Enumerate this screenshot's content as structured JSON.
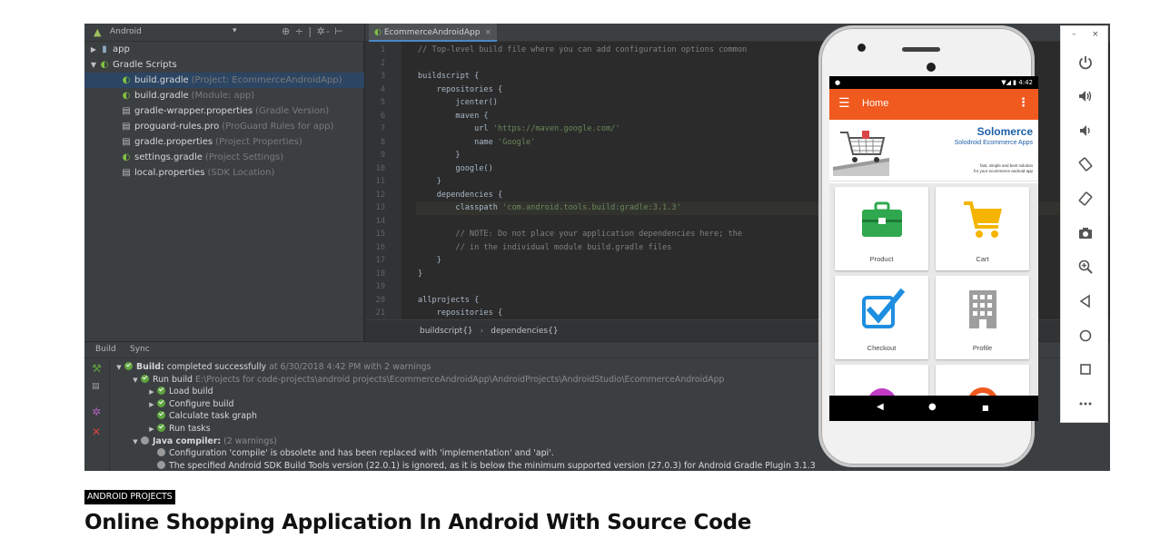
{
  "ide": {
    "project_panel": {
      "view_selector": "Android",
      "tree": [
        {
          "label": "app",
          "detail": "",
          "icon": "folder-icon",
          "arrow": "▶",
          "indent": 0
        },
        {
          "label": "Gradle Scripts",
          "detail": "",
          "icon": "gradle-icon",
          "arrow": "▼",
          "indent": 0
        },
        {
          "label": "build.gradle",
          "detail": "(Project: EcommerceAndroidApp)",
          "icon": "gradle-icon",
          "arrow": "",
          "indent": 1,
          "selected": true
        },
        {
          "label": "build.gradle",
          "detail": "(Module: app)",
          "icon": "gradle-icon",
          "arrow": "",
          "indent": 1
        },
        {
          "label": "gradle-wrapper.properties",
          "detail": "(Gradle Version)",
          "icon": "properties-file-icon",
          "arrow": "",
          "indent": 1
        },
        {
          "label": "proguard-rules.pro",
          "detail": "(ProGuard Rules for app)",
          "icon": "file-icon",
          "arrow": "",
          "indent": 1
        },
        {
          "label": "gradle.properties",
          "detail": "(Project Properties)",
          "icon": "properties-file-icon",
          "arrow": "",
          "indent": 1
        },
        {
          "label": "settings.gradle",
          "detail": "(Project Settings)",
          "icon": "gradle-icon",
          "arrow": "",
          "indent": 1
        },
        {
          "label": "local.properties",
          "detail": "(SDK Location)",
          "icon": "properties-file-icon",
          "arrow": "",
          "indent": 1
        }
      ]
    },
    "editor": {
      "tab_label": "EcommerceAndroidApp",
      "lines": [
        {
          "n": "1",
          "text": "// Top-level build file where you can add configuration options common",
          "kind": "comment"
        },
        {
          "n": "2",
          "text": "",
          "kind": "code"
        },
        {
          "n": "3",
          "text": "buildscript {",
          "kind": "code"
        },
        {
          "n": "4",
          "text": "    repositories {",
          "kind": "code"
        },
        {
          "n": "5",
          "text": "        jcenter()",
          "kind": "code"
        },
        {
          "n": "6",
          "text": "        maven {",
          "kind": "code"
        },
        {
          "n": "7",
          "text": "            url 'https://maven.google.com/'",
          "kind": "string"
        },
        {
          "n": "8",
          "text": "            name 'Google'",
          "kind": "string"
        },
        {
          "n": "9",
          "text": "        }",
          "kind": "code"
        },
        {
          "n": "10",
          "text": "        google()",
          "kind": "code"
        },
        {
          "n": "11",
          "text": "    }",
          "kind": "code"
        },
        {
          "n": "12",
          "text": "    dependencies {",
          "kind": "code"
        },
        {
          "n": "13",
          "text": "        classpath 'com.android.tools.build:gradle:3.1.3'",
          "kind": "string",
          "highlight": true
        },
        {
          "n": "14",
          "text": "",
          "kind": "code"
        },
        {
          "n": "15",
          "text": "        // NOTE: Do not place your application dependencies here; the",
          "kind": "comment"
        },
        {
          "n": "16",
          "text": "        // in the individual module build.gradle files",
          "kind": "comment"
        },
        {
          "n": "17",
          "text": "    }",
          "kind": "code"
        },
        {
          "n": "18",
          "text": "}",
          "kind": "code"
        },
        {
          "n": "19",
          "text": "",
          "kind": "code"
        },
        {
          "n": "20",
          "text": "allprojects {",
          "kind": "code"
        },
        {
          "n": "21",
          "text": "    repositories {",
          "kind": "code"
        }
      ],
      "breadcrumbs": [
        "buildscript{}",
        "dependencies{}"
      ]
    },
    "build_panel": {
      "tabs": [
        "Build",
        "Sync"
      ],
      "rows": [
        {
          "arrow": "▼",
          "status": "ok",
          "bold": "Build:",
          "text": " completed successfully",
          "dim": "  at 6/30/2018 4:42 PM   with 2 warnings",
          "indent": 0
        },
        {
          "arrow": "▼",
          "status": "ok",
          "bold": "",
          "text": "Run build",
          "dim": "  E:\\Projects for code-projects\\android projects\\EcommerceAndroidApp\\AndroidProjects\\AndroidStudio\\EcommerceAndroidApp",
          "indent": 1
        },
        {
          "arrow": "▶",
          "status": "ok",
          "bold": "",
          "text": "Load build",
          "dim": "",
          "indent": 2
        },
        {
          "arrow": "▶",
          "status": "ok",
          "bold": "",
          "text": "Configure build",
          "dim": "",
          "indent": 2
        },
        {
          "arrow": "",
          "status": "ok",
          "bold": "",
          "text": "Calculate task graph",
          "dim": "",
          "indent": 2
        },
        {
          "arrow": "▶",
          "status": "ok",
          "bold": "",
          "text": "Run tasks",
          "dim": "",
          "indent": 2
        },
        {
          "arrow": "▼",
          "status": "grey",
          "bold": "Java compiler:",
          "text": "",
          "dim": "  (2 warnings)",
          "indent": 1
        },
        {
          "arrow": "",
          "status": "grey",
          "bold": "",
          "text": "Configuration 'compile' is obsolete and has been replaced with 'implementation' and 'api'.",
          "dim": "",
          "indent": 2
        },
        {
          "arrow": "",
          "status": "grey",
          "bold": "",
          "text": "The specified Android SDK Build Tools version (22.0.1) is ignored, as it is below the minimum supported version (27.0.3) for Android Gradle Plugin 3.1.3",
          "dim": "",
          "indent": 2
        }
      ]
    }
  },
  "phone_app": {
    "status_time": "4:42",
    "app_title": "Home",
    "banner": {
      "title": "Solomerce",
      "subtitle": "Solodroid Ecommerce Apps",
      "tagline_1": "fast, simple and best solution",
      "tagline_2": "for your ecommerce android app"
    },
    "tiles": [
      {
        "label": "Product",
        "icon": "briefcase-icon",
        "color": "#2fa84f"
      },
      {
        "label": "Cart",
        "icon": "shopping-cart-icon",
        "color": "#f5b400"
      },
      {
        "label": "Checkout",
        "icon": "checkbox-icon",
        "color": "#1e8ee0"
      },
      {
        "label": "Profile",
        "icon": "building-icon",
        "color": "#9e9e9e"
      }
    ],
    "accent_color": "#f05a1e"
  },
  "emulator_toolbar": {
    "window_controls": [
      "–",
      "×"
    ],
    "buttons": [
      "power-icon",
      "volume-up-icon",
      "volume-down-icon",
      "rotate-left-icon",
      "rotate-right-icon",
      "camera-icon",
      "zoom-icon",
      "back-icon",
      "home-icon",
      "overview-icon",
      "more-icon"
    ]
  },
  "article": {
    "category": "ANDROID PROJECTS",
    "title": "Online Shopping Application In Android With Source Code"
  }
}
